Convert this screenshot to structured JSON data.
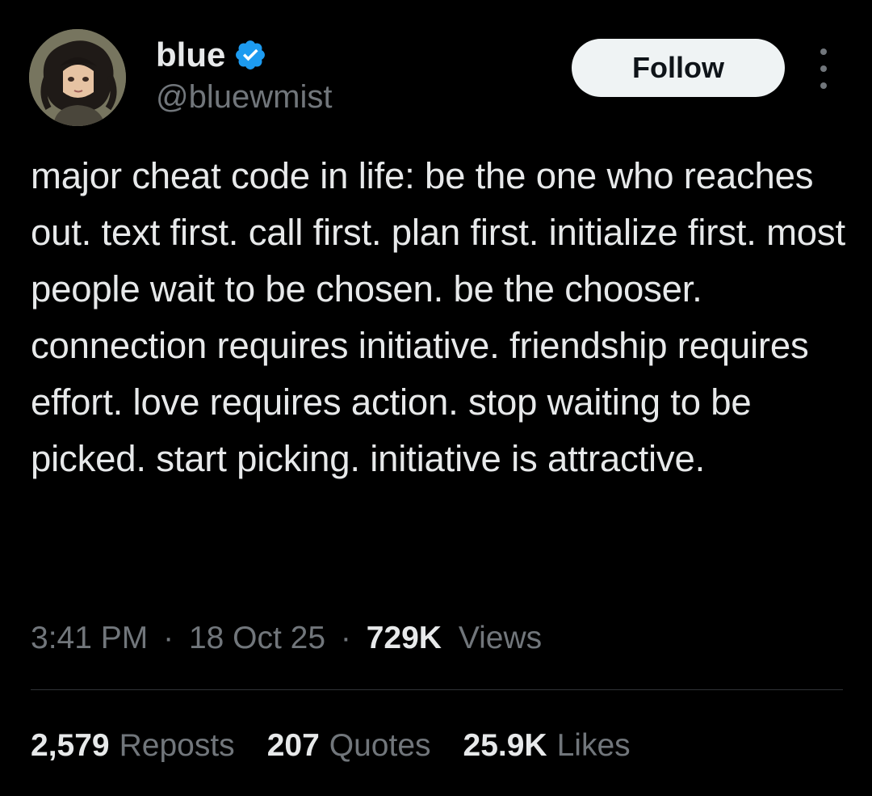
{
  "author": {
    "display_name": "blue",
    "handle": "@bluewmist",
    "verified": true
  },
  "actions": {
    "follow_label": "Follow"
  },
  "tweet": {
    "text": "major cheat code in life: be the one who reaches out. text first. call first. plan first. initialize first. most people wait to be chosen. be the chooser. connection requires initiative. friendship requires effort. love requires action. stop waiting to be picked. start picking. initiative is attractive."
  },
  "meta": {
    "time": "3:41 PM",
    "separator": "·",
    "date": "18 Oct 25",
    "views_count": "729K",
    "views_label": "Views"
  },
  "stats": {
    "reposts_count": "2,579",
    "reposts_label": "Reposts",
    "quotes_count": "207",
    "quotes_label": "Quotes",
    "likes_count": "25.9K",
    "likes_label": "Likes"
  },
  "colors": {
    "background": "#000000",
    "primary_text": "#e7e9ea",
    "secondary_text": "#71767b",
    "verified_badge": "#1d9bf0",
    "button_bg": "#eff3f4"
  },
  "icons": {
    "verified": "verified-badge-icon",
    "more": "more-options-icon"
  }
}
